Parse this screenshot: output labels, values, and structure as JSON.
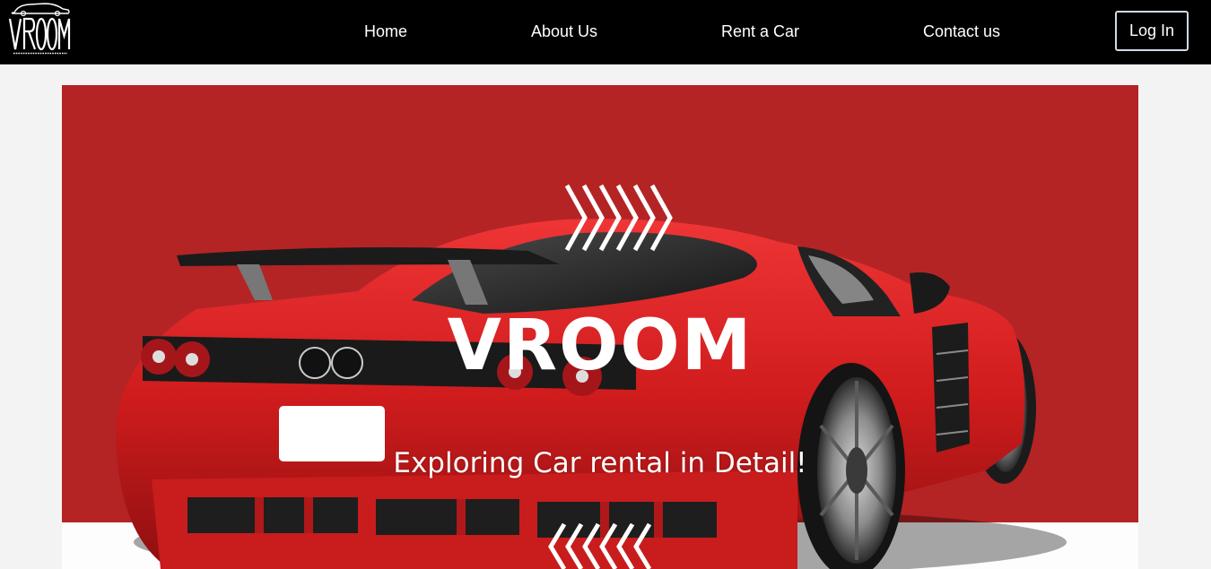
{
  "brand": {
    "logo_text": "VROOM",
    "logo_tagline": "CAR RENTAL SERVICES"
  },
  "nav": {
    "items": [
      {
        "label": "Home"
      },
      {
        "label": "About Us"
      },
      {
        "label": "Rent a Car"
      },
      {
        "label": "Contact us"
      }
    ],
    "login_label": "Log In"
  },
  "hero": {
    "title": "VROOM",
    "subtitle": "Exploring Car rental in Detail!",
    "background_color": "#b42425",
    "car_color": "#d81f20",
    "decoration_icon": "chevron-arrows-icon"
  },
  "colors": {
    "navbar": "#000000",
    "page_background": "#f3f3f3",
    "login_border": "#cfdbe6"
  }
}
